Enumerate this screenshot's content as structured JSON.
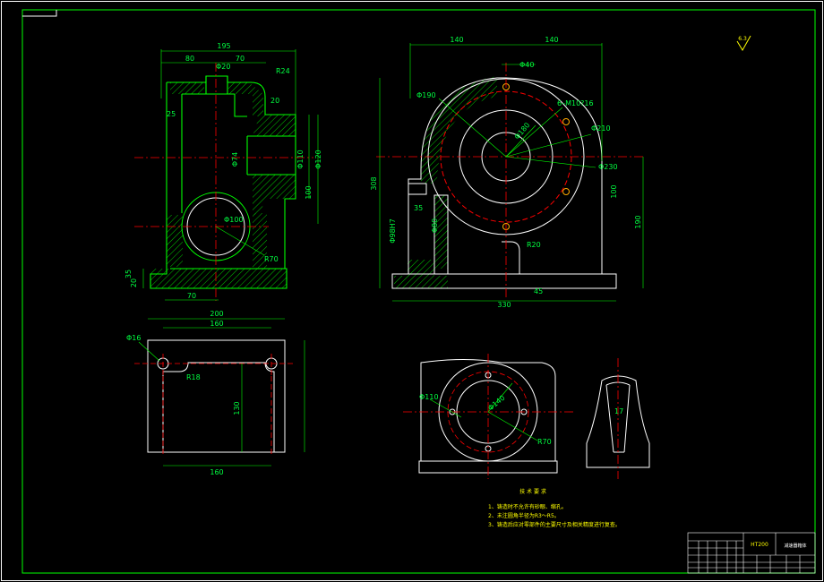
{
  "sheet": {
    "background": "#000000",
    "frame_color": "#ffffff",
    "outline_color": "#00ff00",
    "centerline_color": "#ff0000",
    "hatch_color": "#00c800",
    "note_color": "#ffff00"
  },
  "front_view": {
    "overall_width": "195",
    "dim_left": "80",
    "dim_right": "70",
    "bore_top": "Φ20",
    "radius_top": "R24",
    "wall": "20",
    "height_25": "25",
    "bore_74": "Φ74",
    "bore_110": "Φ110",
    "bore_120": "Φ120",
    "height_100": "100",
    "bore_100": "Φ100",
    "radius_70": "R70",
    "base_35": "35",
    "base_20": "20",
    "base_width": "70"
  },
  "side_view": {
    "dim_140_left": "140",
    "dim_140_right": "140",
    "bore_40": "Φ40",
    "bore_190": "Φ190",
    "threads": "6–M10?16",
    "bore_210": "Φ210",
    "pcd_180": "Φ180",
    "bore_230": "Φ230",
    "height_308": "308",
    "dim_35": "35",
    "bore_98": "Φ98H7",
    "bore_80": "Φ80",
    "radius_20": "R20",
    "tol": "100",
    "height_190": "190",
    "width_330": "330",
    "dim_45": "45"
  },
  "top_view": {
    "overall_width": "200",
    "inner_width": "160",
    "hole": "Φ16",
    "radius": "R18",
    "height": "130",
    "bottom_width": "160"
  },
  "section_view": {
    "bore_110": "Φ110",
    "pcd_140": "Φ140",
    "radius_70": "R70"
  },
  "rib_view": {
    "dim": "17"
  },
  "surface_mark": "6.3",
  "tech_requirements": {
    "title": "技 术 要 求",
    "items": [
      "1、铸造时不允许有砂眼、缩孔。",
      "2、未注圆角半径为R3～R5。",
      "3、铸造后应对零部件的主要尺寸及相关精度进行复查。"
    ]
  },
  "title_block": {
    "material": "HT200",
    "part_name": "减速器箱体"
  }
}
